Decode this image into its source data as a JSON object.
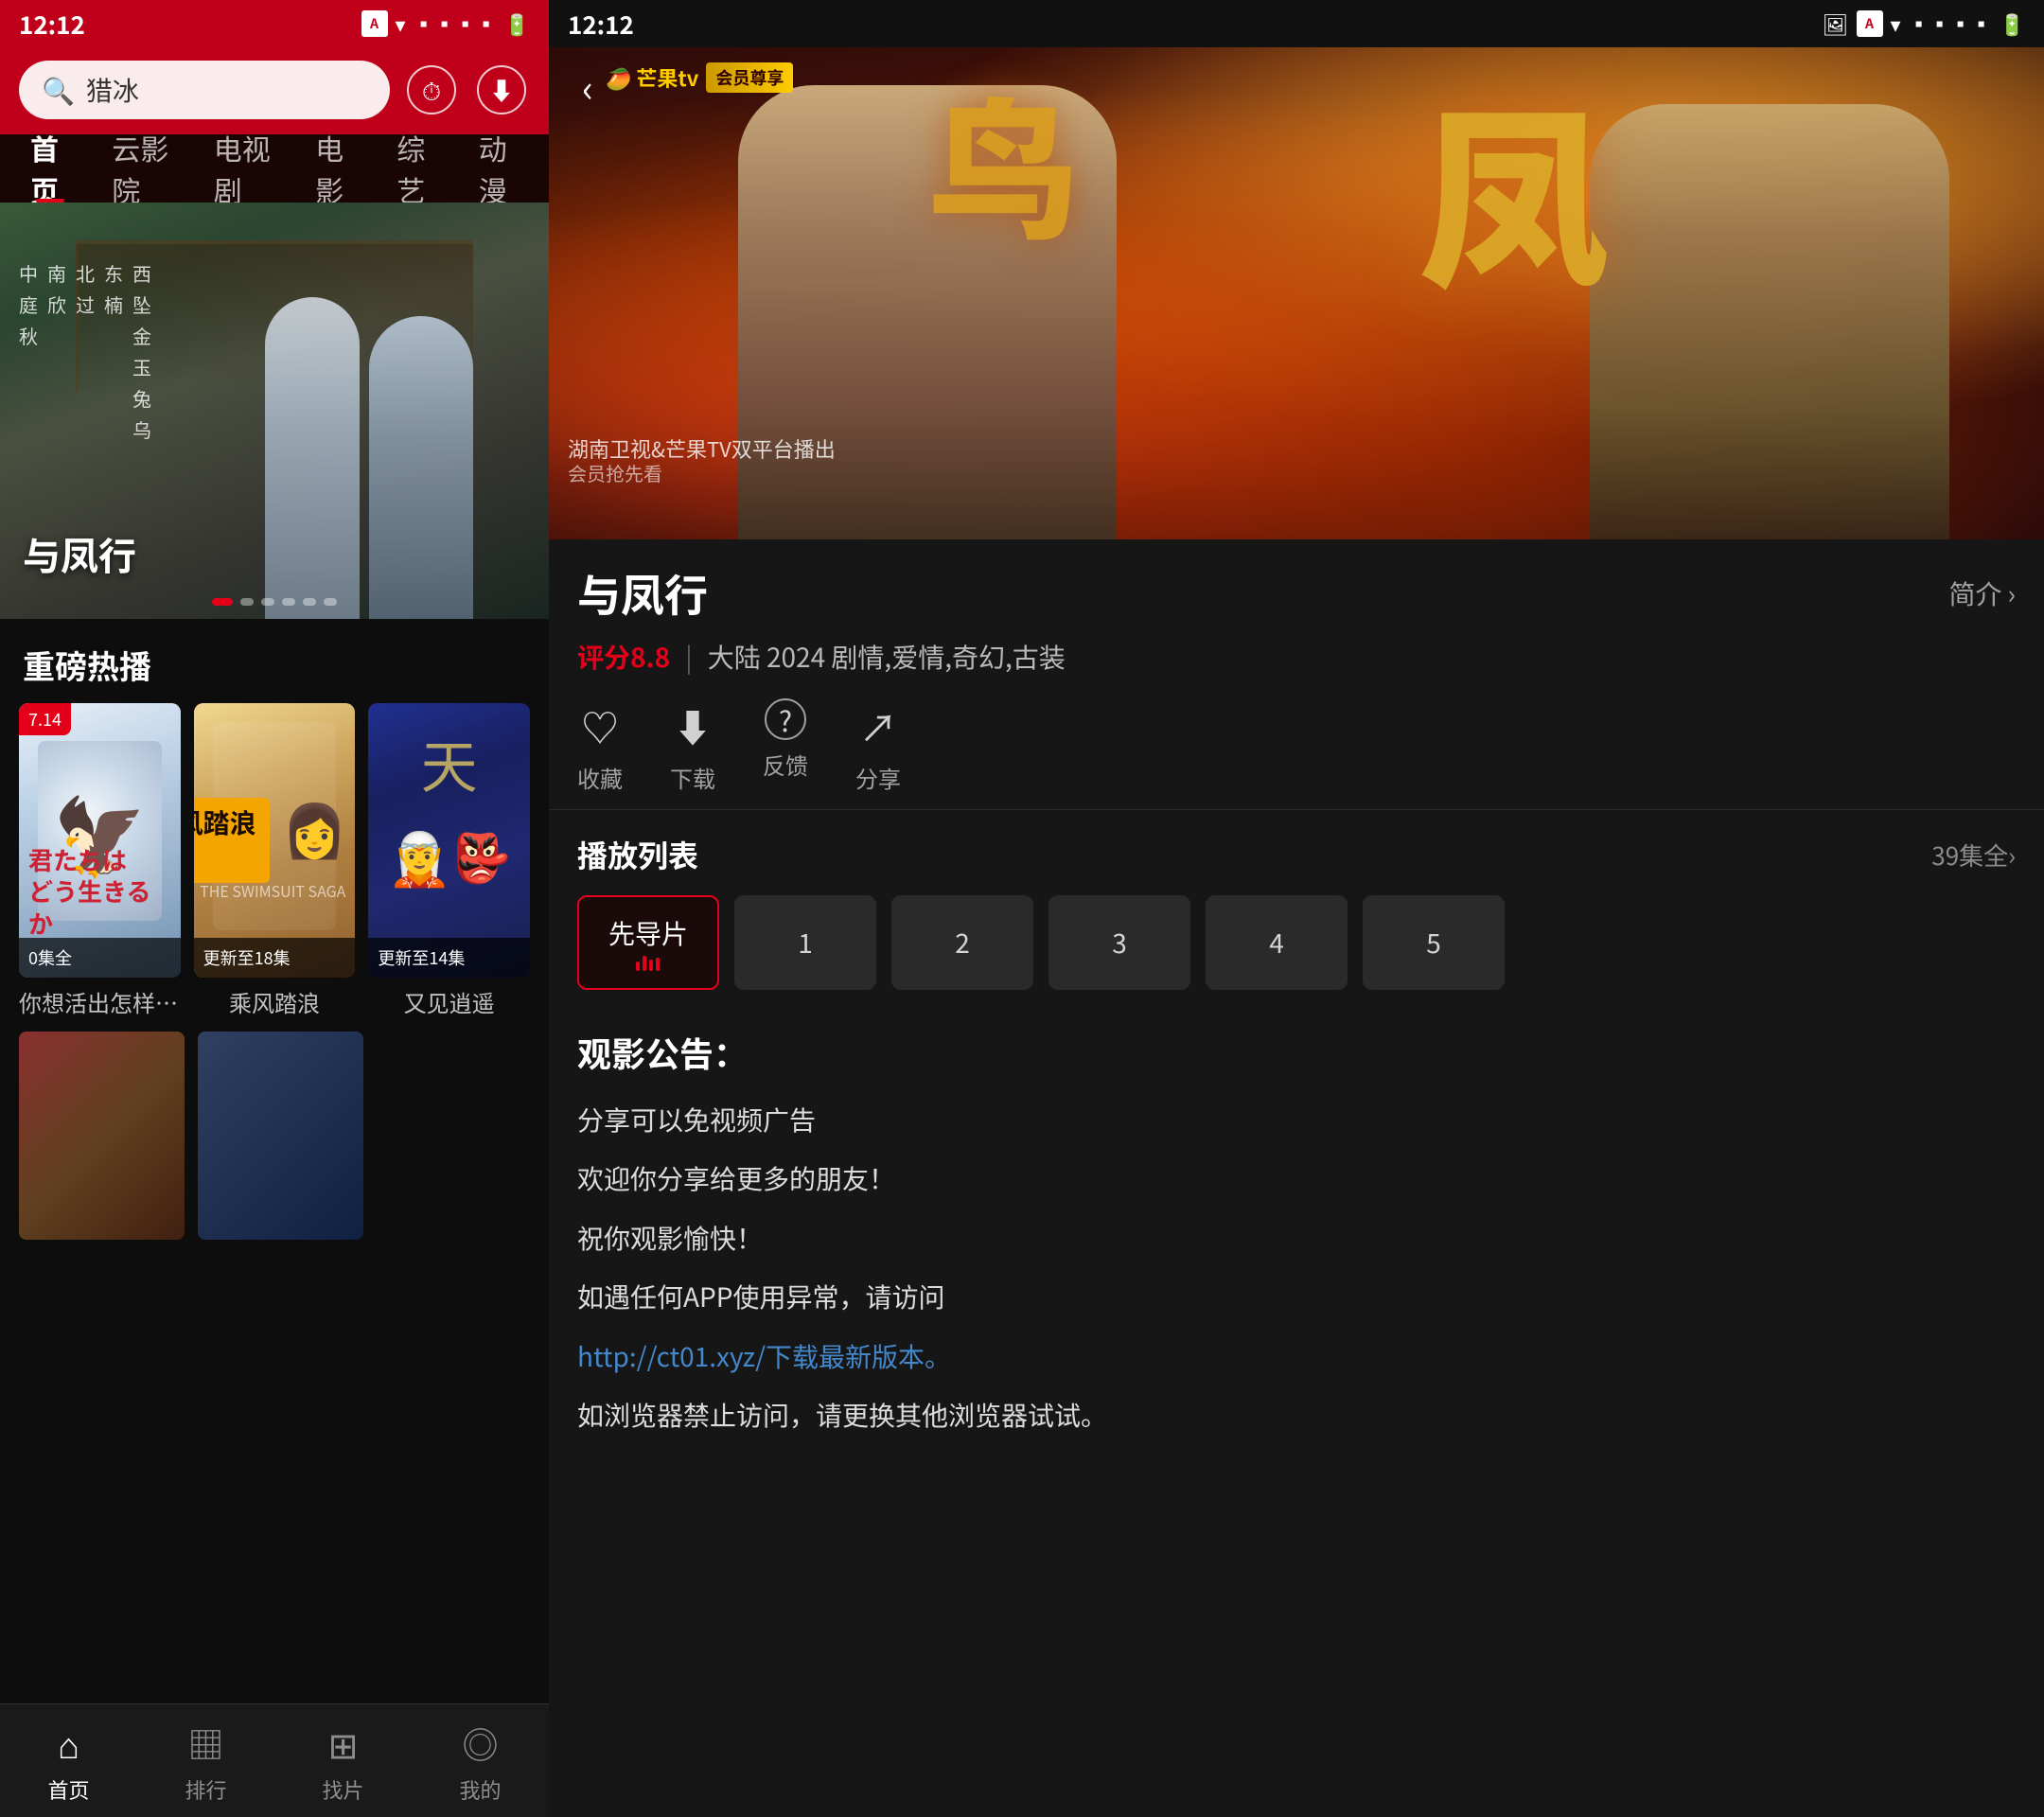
{
  "left": {
    "statusBar": {
      "time": "12:12",
      "iconA": "A"
    },
    "search": {
      "placeholder": "猎冰",
      "historyLabel": "历史",
      "downloadLabel": "下载"
    },
    "navTabs": [
      {
        "label": "首页",
        "active": true
      },
      {
        "label": "云影院",
        "active": false
      },
      {
        "label": "电视剧",
        "active": false
      },
      {
        "label": "电影",
        "active": false
      },
      {
        "label": "综艺",
        "active": false
      },
      {
        "label": "动漫",
        "active": false
      }
    ],
    "heroBanner": {
      "title": "与凤行",
      "subtitleCols": [
        [
          "中",
          "庭",
          "秋"
        ],
        [
          "南",
          "欣",
          ""
        ],
        [
          "北",
          "过",
          ""
        ],
        [
          "东",
          "楠",
          ""
        ],
        [
          "西",
          "坠",
          ""
        ],
        [
          "",
          "金",
          ""
        ],
        [
          "",
          "玉",
          ""
        ],
        [
          "",
          "兔",
          ""
        ],
        [
          "",
          "乌",
          ""
        ]
      ],
      "dots": [
        true,
        false,
        false,
        false,
        false,
        false
      ]
    },
    "hotSection": {
      "title": "重磅热播",
      "cards": [
        {
          "badge": "7.14",
          "progress": "0集全",
          "name": "你想活出怎样的...",
          "japaneseText": "君たちはどう生きるか"
        },
        {
          "progress": "更新至18集",
          "name": "乘风踏浪",
          "cnBadge": "乘风踏浪"
        },
        {
          "progress": "更新至14集",
          "name": "又见逍遥",
          "topText": "天"
        }
      ]
    },
    "bottomNav": [
      {
        "label": "首页",
        "icon": "⌂",
        "active": true
      },
      {
        "label": "排行",
        "icon": "▦",
        "active": false
      },
      {
        "label": "找片",
        "icon": "⊞",
        "active": false
      },
      {
        "label": "我的",
        "icon": "⚇",
        "active": false
      }
    ]
  },
  "right": {
    "statusBar": {
      "time": "12:12",
      "iconA": "A"
    },
    "detail": {
      "backBtn": "‹",
      "mangoLogo": "🥭 芒果tv",
      "vipBadge": "会员尊享",
      "broadcastText": "湖南卫视&芒果TV双平台播出",
      "broadcastSub": "会员抢先看",
      "bigChar": "凤",
      "title": "与凤行",
      "introLabel": "简介",
      "introArrow": "›",
      "score": "评分8.8",
      "scoreSep": "|",
      "metaInfo": "大陆  2024  剧情,爱情,奇幻,古装",
      "actions": [
        {
          "icon": "♡",
          "label": "收藏"
        },
        {
          "icon": "⬇",
          "label": "下载"
        },
        {
          "icon": "?",
          "label": "反馈"
        },
        {
          "icon": "↗",
          "label": "分享"
        }
      ],
      "playlistTitle": "播放列表",
      "playlistAll": "39集全",
      "episodes": [
        {
          "label": "先导片",
          "active": true,
          "playing": true
        },
        {
          "label": "1",
          "active": false
        },
        {
          "label": "2",
          "active": false
        },
        {
          "label": "3",
          "active": false
        },
        {
          "label": "4",
          "active": false
        },
        {
          "label": "5",
          "active": false
        }
      ],
      "announcementTitle": "观影公告：",
      "announcementLines": [
        "分享可以免视频广告",
        "欢迎你分享给更多的朋友！",
        "祝你观影愉快！",
        "如遇任何APP使用异常，请访问",
        "如浏览器禁止访问，请更换其他浏览器试试。"
      ],
      "announcementLink": "http://ct01.xyz/下载最新版本。"
    }
  }
}
